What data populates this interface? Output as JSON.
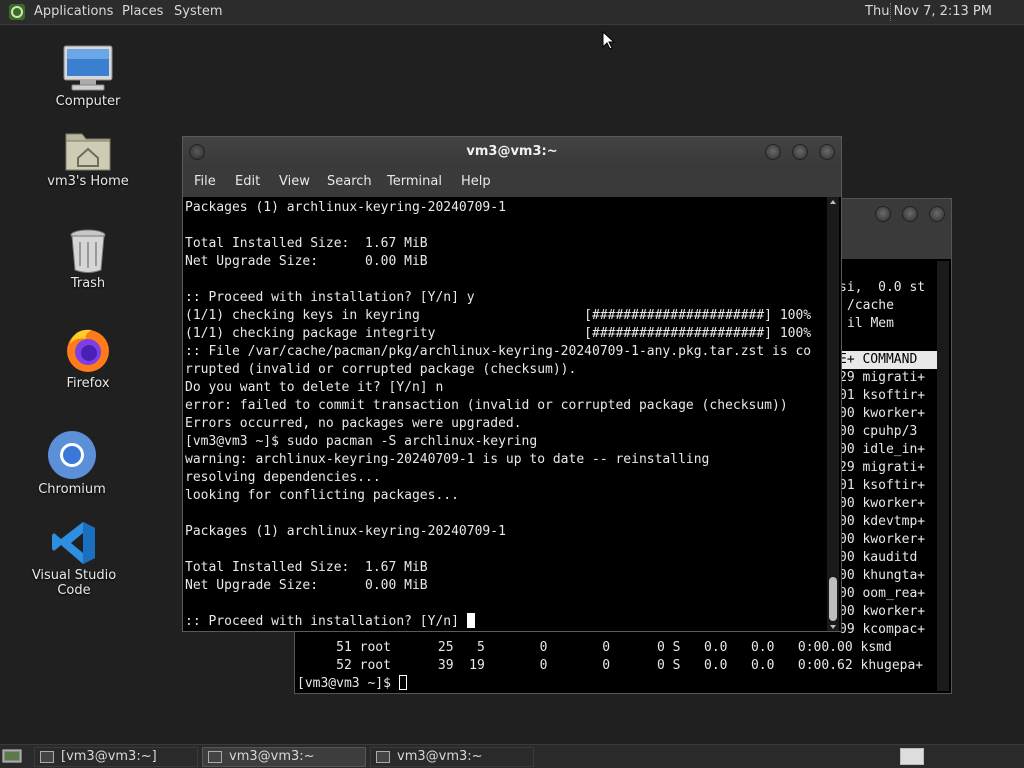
{
  "top_panel": {
    "menus": [
      "Applications",
      "Places",
      "System"
    ],
    "clock": "Thu Nov 7,  2:13 PM"
  },
  "desktop_icons": [
    {
      "label": "Computer",
      "icon": "computer-icon"
    },
    {
      "label": "vm3's Home",
      "icon": "home-folder-icon"
    },
    {
      "label": "Trash",
      "icon": "trash-icon"
    },
    {
      "label": "Firefox",
      "icon": "firefox-icon"
    },
    {
      "label": "Chromium",
      "icon": "chromium-icon"
    },
    {
      "label": "Visual Studio Code",
      "icon": "vscode-icon"
    }
  ],
  "front_window": {
    "title": "vm3@vm3:~",
    "menu": [
      "File",
      "Edit",
      "View",
      "Search",
      "Terminal",
      "Help"
    ],
    "lines": [
      "Packages (1) archlinux-keyring-20240709-1",
      "",
      "Total Installed Size:  1.67 MiB",
      "Net Upgrade Size:      0.00 MiB",
      "",
      ":: Proceed with installation? [Y/n] y",
      "(1/1) checking keys in keyring                     [######################] 100%",
      "(1/1) checking package integrity                   [######################] 100%",
      ":: File /var/cache/pacman/pkg/archlinux-keyring-20240709-1-any.pkg.tar.zst is co",
      "rrupted (invalid or corrupted package (checksum)).",
      "Do you want to delete it? [Y/n] n",
      "error: failed to commit transaction (invalid or corrupted package (checksum))",
      "Errors occurred, no packages were upgraded.",
      "[vm3@vm3 ~]$ sudo pacman -S archlinux-keyring",
      "warning: archlinux-keyring-20240709-1 is up to date -- reinstalling",
      "resolving dependencies...",
      "looking for conflicting packages...",
      "",
      "Packages (1) archlinux-keyring-20240709-1",
      "",
      "Total Installed Size:  1.67 MiB",
      "Net Upgrade Size:      0.00 MiB",
      "",
      ":: Proceed with installation? [Y/n] "
    ]
  },
  "back_window": {
    "right_lines": [
      "si,  0.0 st",
      "/cache",
      "il Mem",
      "",
      "E+ COMMAND",
      "29 migrati+",
      "01 ksoftir+",
      "00 kworker+",
      "00 cpuhp/3",
      "00 idle_in+",
      "29 migrati+",
      "01 ksoftir+",
      "00 kworker+",
      "00 kdevtmp+",
      "00 kworker+",
      "00 kauditd",
      "00 khungta+",
      "00 oom_rea+",
      "00 kworker+",
      "09 kcompac+"
    ],
    "rows": [
      "     51 root      25   5       0       0      0 S   0.0   0.0   0:00.00 ksmd",
      "     52 root      39  19       0       0      0 S   0.0   0.0   0:00.62 khugepa+"
    ],
    "prompt": "[vm3@vm3 ~]$ "
  },
  "taskbar": {
    "tasks": [
      "[vm3@vm3:~]",
      "vm3@vm3:~",
      "vm3@vm3:~"
    ]
  }
}
